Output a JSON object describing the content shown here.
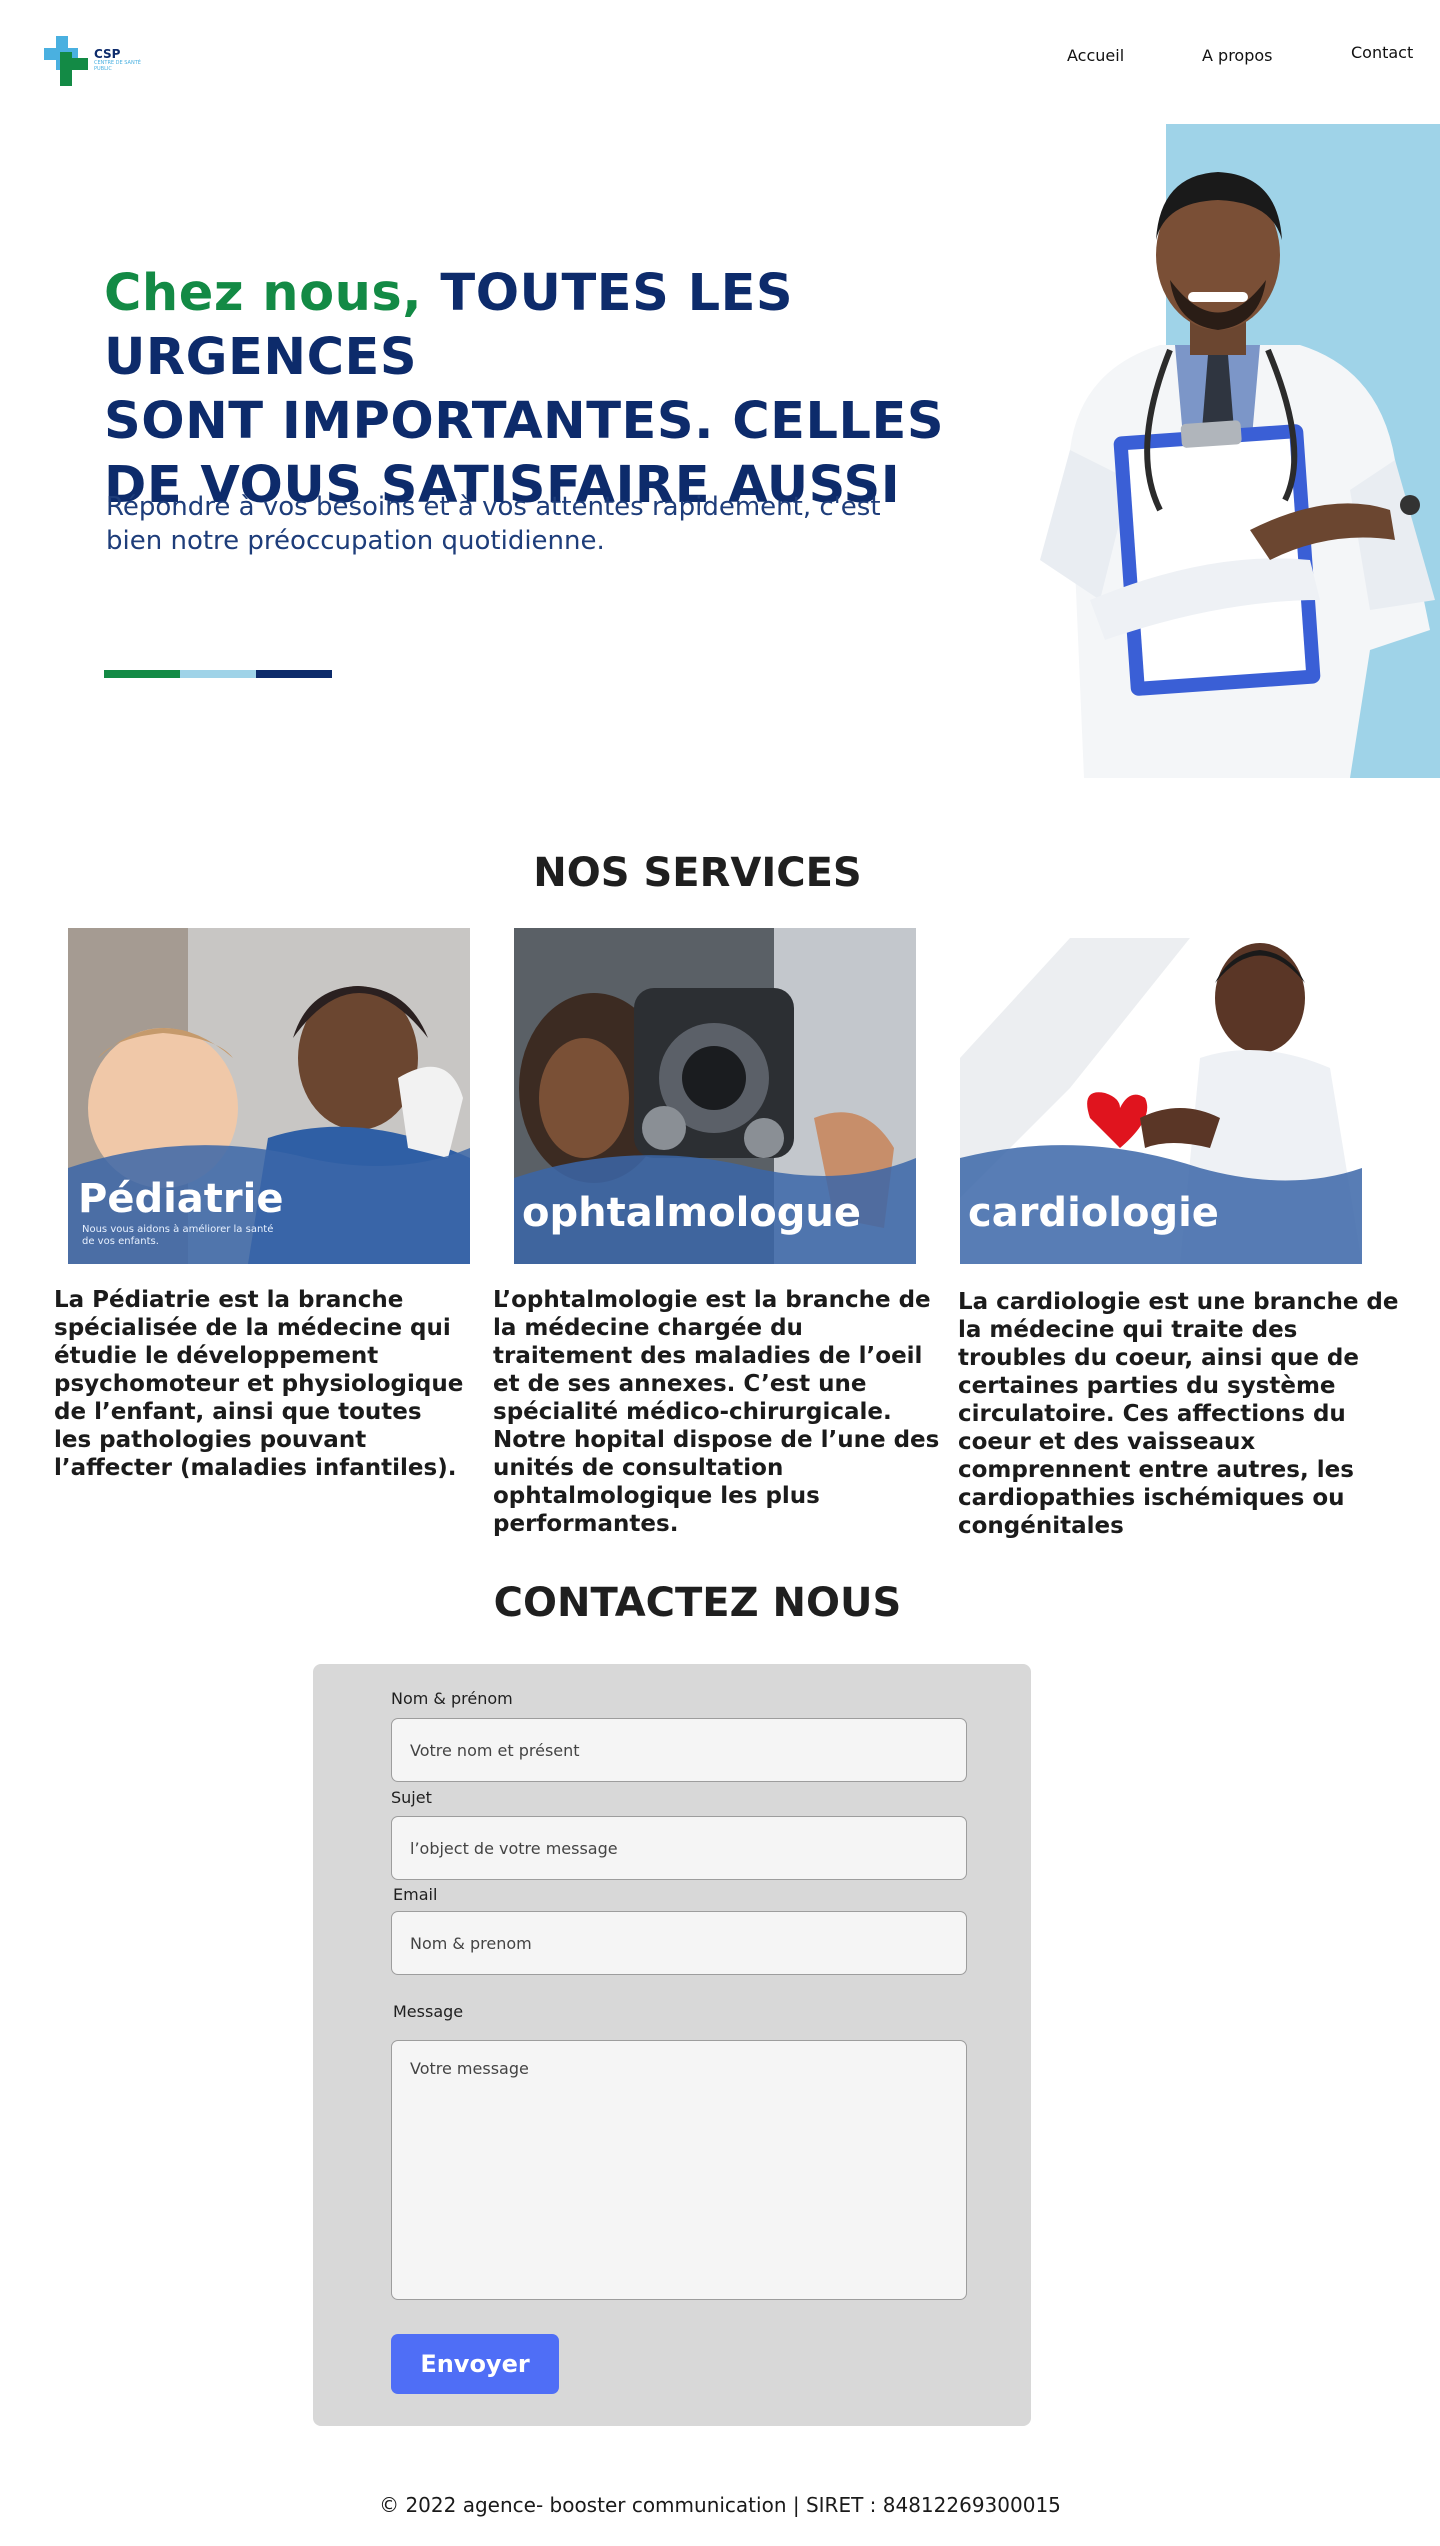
{
  "header": {
    "logo": {
      "title": "CSP",
      "subtitle": "Centre de santé public"
    },
    "nav": [
      {
        "label": "Accueil"
      },
      {
        "label": "A propos"
      },
      {
        "label": "Contact"
      }
    ]
  },
  "hero": {
    "title_green": "Chez nous,",
    "title_rest_line1": " TOUTES LES URGENCES",
    "title_line2": "SONT IMPORTANTES.  CELLES",
    "title_line3": "DE VOUS SATISFAIRE AUSSI",
    "subtitle": "Répondre à vos besoins et à vos attentes rapidement, c'est bien notre préoccupation quotidienne.",
    "bar_colors": [
      "#138a45",
      "#9fd3e8",
      "#0d2b6b"
    ]
  },
  "services": {
    "title": "NOS SERVICES",
    "cards": [
      {
        "label": "Pédiatrie",
        "small": "Nous vous aidons à améliorer la santé de vos enfants.",
        "text": "La Pédiatrie est la branche spécialisée de la médecine qui étudie le développement psychomoteur et physiologique de l’enfant, ainsi que toutes les pathologies pouvant l’affecter (maladies infantiles)."
      },
      {
        "label": "ophtalmologue",
        "text": "L’ophtalmologie est la branche de la médecine chargée du traitement des maladies de l’oeil et de ses annexes. C’est une spécialité médico-chirurgicale. Notre hopital dispose de l’une des unités de consultation ophtalmologique les plus performantes."
      },
      {
        "label": "cardiologie",
        "text": "La cardiologie est une branche de la médecine qui traite des troubles du coeur, ainsi que de certaines parties du système circulatoire. Ces affections du coeur et des vaisseaux comprennent entre autres, les cardiopathies ischémiques ou congénitales"
      }
    ]
  },
  "contact": {
    "title": "CONTACTEZ NOUS",
    "name_label": "Nom & prénom",
    "name_placeholder": "Votre nom et présent",
    "subject_label": "Sujet",
    "subject_placeholder": "l’object de votre message",
    "email_label": "Email",
    "email_placeholder": "Nom & prenom",
    "message_label": "Message",
    "message_placeholder": "Votre message",
    "submit_label": "Envoyer"
  },
  "footer": {
    "text": "© 2022 agence- booster communication   | SIRET : 84812269300015"
  }
}
